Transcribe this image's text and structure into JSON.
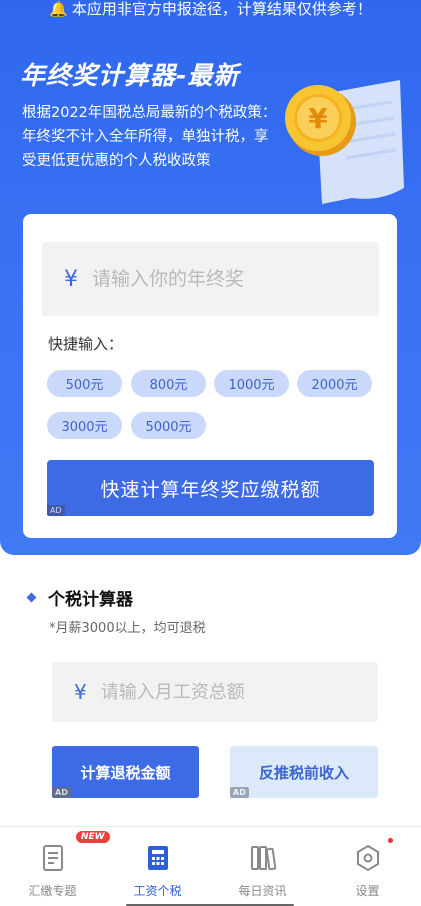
{
  "notice": {
    "text": "本应用非官方申报途径，计算结果仅供参考！"
  },
  "hero": {
    "title": "年终奖计算器-最新",
    "description": "根据2022年国税总局最新的个税政策：年终奖不计入全年所得，单独计税，享受更低更优惠的个人税收政策"
  },
  "bonus_card": {
    "currency_symbol": "¥",
    "input_placeholder": "请输入你的年终奖",
    "quick_label": "快捷输入：",
    "chips": [
      "500元",
      "800元",
      "1000元",
      "2000元",
      "3000元",
      "5000元"
    ],
    "calc_button": "快速计算年终奖应缴税额",
    "ad_label": "AD"
  },
  "tax_section": {
    "title": "个税计算器",
    "subtitle": "*月薪3000以上，均可退税",
    "currency_symbol": "¥",
    "input_placeholder": "请输入月工资总额",
    "refund_button": "计算退税金额",
    "reverse_button": "反推税前收入",
    "ad_label": "AD"
  },
  "tabbar": {
    "tabs": [
      {
        "label": "汇缴专题",
        "icon": "document-icon",
        "badge": "NEW",
        "active": false
      },
      {
        "label": "工资个税",
        "icon": "calculator-icon",
        "active": true
      },
      {
        "label": "每日资讯",
        "icon": "books-icon",
        "active": false
      },
      {
        "label": "设置",
        "icon": "settings-icon",
        "active": false
      }
    ]
  },
  "colors": {
    "primary": "#3d6be6",
    "hero_bg": "#3b74f3",
    "chip_bg": "#c9d8fb",
    "badge_red": "#ee3f3f"
  }
}
